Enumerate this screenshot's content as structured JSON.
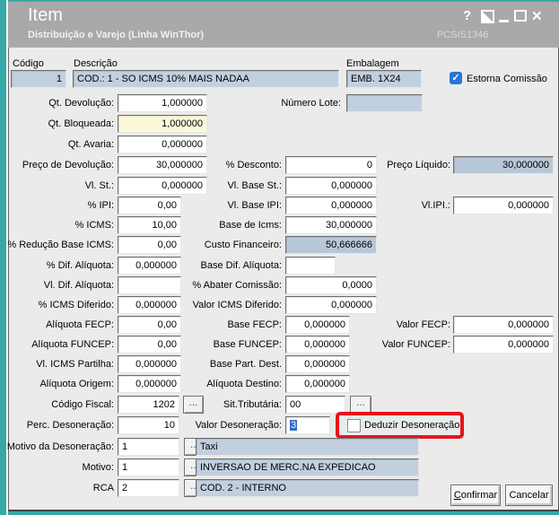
{
  "window": {
    "title": "Item",
    "subtitle": "Distribuição e Varejo (Linha WinThor)",
    "system_code": "PCSIS1346",
    "icons": {
      "help": "?",
      "close": "✕"
    }
  },
  "ui": {
    "ellipsis": "...",
    "check_glyph": "✓"
  },
  "colors": {
    "accent_teal": "#35a8a8",
    "titlebar_gray": "#a9a9a9",
    "content_bg": "#ebebeb",
    "readonly_field_bg": "#c2cfdf",
    "calculated_field_bg": "#b7c7d7",
    "blocked_field_bg": "#fbf8d8",
    "selection_blue": "#316ac5",
    "checkbox_blue": "#2577d4",
    "annotation_red": "#e8131c"
  },
  "header": {
    "codigo": {
      "label": "Código",
      "value": "1"
    },
    "descricao": {
      "label": "Descrição",
      "value": "COD.: 1 - SO ICMS 10% MAIS NADAA"
    },
    "embalagem": {
      "label": "Embalagem",
      "value": "EMB. 1X24"
    },
    "estorna_comissao": {
      "label": "Estorna Comissão",
      "checked": true
    }
  },
  "fields": {
    "qt_devolucao": {
      "label": "Qt. Devolução:",
      "value": "1,000000"
    },
    "numero_lote": {
      "label": "Número Lote:",
      "value": ""
    },
    "qt_bloqueada": {
      "label": "Qt. Bloqueada:",
      "value": "1,000000"
    },
    "qt_avaria": {
      "label": "Qt. Avaria:",
      "value": "0,000000"
    },
    "preco_devolucao": {
      "label": "Preço de Devolução:",
      "value": "30,000000"
    },
    "perc_desconto": {
      "label": "% Desconto:",
      "value": "0"
    },
    "preco_liquido": {
      "label": "Preço Líquido:",
      "value": "30,000000"
    },
    "vl_st": {
      "label": "Vl. St.:",
      "value": "0,000000"
    },
    "vl_base_st": {
      "label": "Vl. Base St.:",
      "value": "0,000000"
    },
    "perc_ipi": {
      "label": "% IPI:",
      "value": "0,00"
    },
    "vl_base_ipi": {
      "label": "Vl. Base IPI:",
      "value": "0,000000"
    },
    "vl_ipi": {
      "label": "Vl.IPI.:",
      "value": "0,000000"
    },
    "perc_icms": {
      "label": "% ICMS:",
      "value": "10,00"
    },
    "base_icms": {
      "label": "Base de Icms:",
      "value": "30,000000"
    },
    "perc_reducao_base_icms": {
      "label": "% Redução Base ICMS:",
      "value": "0,00"
    },
    "custo_financeiro": {
      "label": "Custo Financeiro:",
      "value": "50,666666"
    },
    "perc_dif_aliquota": {
      "label": "% Dif. Alíquota:",
      "value": "0,000000"
    },
    "base_dif_aliquota": {
      "label": "Base Dif. Alíquota:",
      "value": ""
    },
    "vl_dif_aliquota": {
      "label": "Vl. Dif. Alíquota:",
      "value": ""
    },
    "perc_abater_comissao": {
      "label": "% Abater Comissão:",
      "value": "0,0000"
    },
    "perc_icms_diferido": {
      "label": "% ICMS Diferido:",
      "value": "0,000000"
    },
    "valor_icms_diferido": {
      "label": "Valor ICMS Diferido:",
      "value": "0,000000"
    },
    "aliquota_fecp": {
      "label": "Alíquota FECP:",
      "value": "0,00"
    },
    "base_fecp": {
      "label": "Base FECP:",
      "value": "0,000000"
    },
    "valor_fecp": {
      "label": "Valor FECP:",
      "value": "0,000000"
    },
    "aliquota_funcep": {
      "label": "Alíquota FUNCEP:",
      "value": "0,00"
    },
    "base_funcep": {
      "label": "Base FUNCEP:",
      "value": "0,000000"
    },
    "valor_funcep": {
      "label": "Valor FUNCEP:",
      "value": "0,000000"
    },
    "vl_icms_partilha": {
      "label": "Vl. ICMS Partilha:",
      "value": "0,000000"
    },
    "base_part_dest": {
      "label": "Base Part. Dest.",
      "value": "0,000000"
    },
    "aliquota_origem": {
      "label": "Alíquota Origem:",
      "value": "0,000000"
    },
    "aliquota_destino": {
      "label": "Alíquota Destino:",
      "value": "0,000000"
    },
    "codigo_fiscal": {
      "label": "Código Fiscal:",
      "value": "1202"
    },
    "sit_tributaria": {
      "label": "Sit.Tributária:",
      "value": "00"
    },
    "perc_desoneracao": {
      "label": "Perc. Desoneração:",
      "value": "10"
    },
    "valor_desoneracao": {
      "label": "Valor Desoneração:",
      "value": "3",
      "selected": true
    },
    "deduzir_desoneracao": {
      "label": "Deduzir Desoneração",
      "checked": false
    },
    "motivo_desoneracao": {
      "label": "Motivo da Desoneração:",
      "value": "1",
      "description": "Taxi"
    },
    "motivo": {
      "label": "Motivo:",
      "value": "1",
      "description": "INVERSAO DE MERC.NA EXPEDICAO"
    },
    "rca": {
      "label": "RCA",
      "value": "2",
      "description": "COD. 2 - INTERNO"
    }
  },
  "buttons": {
    "confirmar": "Confirmar",
    "cancelar": "Cancelar"
  }
}
